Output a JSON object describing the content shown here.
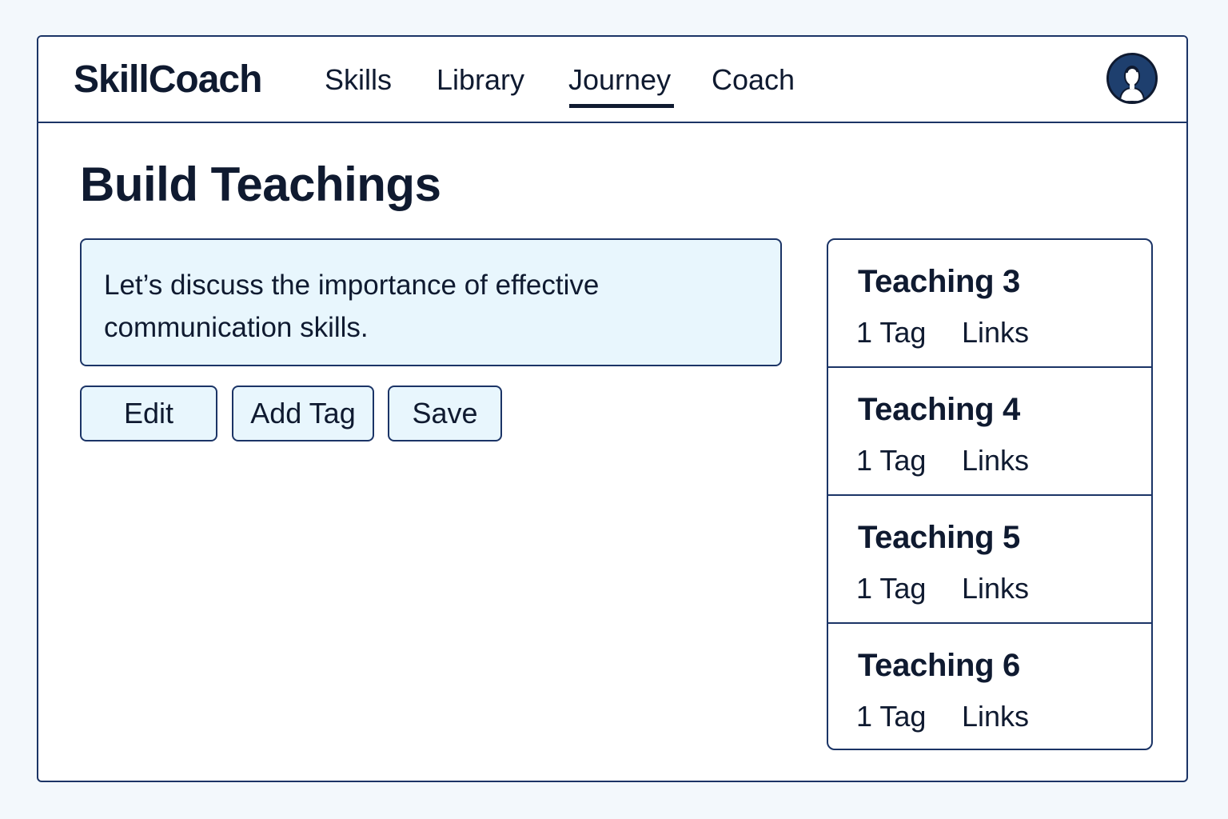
{
  "app": {
    "brand": "SkillCoach",
    "nav": [
      {
        "label": "Skills",
        "active": false
      },
      {
        "label": "Library",
        "active": false
      },
      {
        "label": "Journey",
        "active": true
      },
      {
        "label": "Coach",
        "active": false
      }
    ],
    "avatar_icon": "user-avatar-icon"
  },
  "main": {
    "title": "Build Teachings",
    "message": "Let’s discuss the importance of effective communication skills.",
    "buttons": {
      "edit": "Edit",
      "add_tag": "Add Tag",
      "save": "Save"
    }
  },
  "teachings": [
    {
      "title": "Teaching 3",
      "tag": "1 Tag",
      "links": "Links"
    },
    {
      "title": "Teaching 4",
      "tag": "1 Tag",
      "links": "Links"
    },
    {
      "title": "Teaching 5",
      "tag": "1 Tag",
      "links": "Links"
    },
    {
      "title": "Teaching 6",
      "tag": "1 Tag",
      "links": "Links"
    }
  ],
  "colors": {
    "border": "#1b3466",
    "text": "#0f1a30",
    "accent_fill": "#e8f6fd",
    "avatar_bg": "#1e3f6e"
  }
}
